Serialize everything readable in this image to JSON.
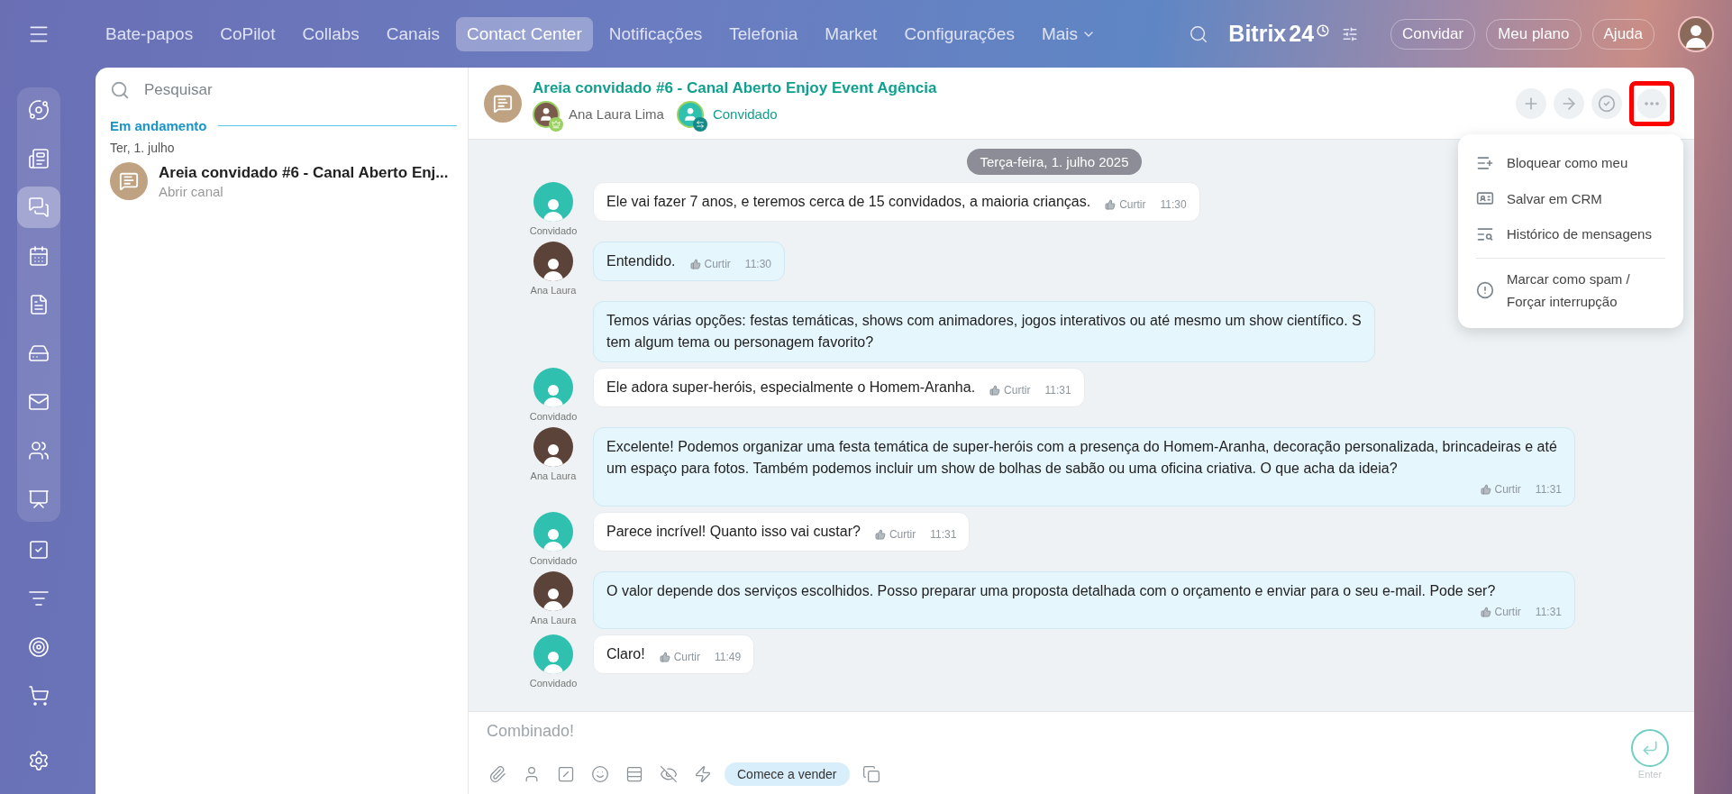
{
  "topbar": {
    "nav": [
      {
        "label": "Bate-papos",
        "selected": false
      },
      {
        "label": "CoPilot",
        "selected": false
      },
      {
        "label": "Collabs",
        "selected": false
      },
      {
        "label": "Canais",
        "selected": false
      },
      {
        "label": "Contact Center",
        "selected": true
      },
      {
        "label": "Notificações",
        "selected": false
      },
      {
        "label": "Telefonia",
        "selected": false
      },
      {
        "label": "Market",
        "selected": false
      },
      {
        "label": "Configurações",
        "selected": false
      },
      {
        "label": "Mais",
        "selected": false,
        "kind": "dropdown"
      }
    ],
    "logo": "Bitrix",
    "logo_number": "24",
    "buttons": [
      "Convidar",
      "Meu plano",
      "Ajuda"
    ]
  },
  "rail": {
    "items": [
      {
        "selected": false
      },
      {
        "selected": false
      },
      {
        "selected": true
      },
      {
        "selected": false
      },
      {
        "selected": false
      },
      {
        "selected": false
      },
      {
        "selected": false
      },
      {
        "selected": false
      },
      {
        "selected": false
      },
      {
        "selected": false
      },
      {
        "selected": false
      },
      {
        "selected": false
      },
      {
        "selected": false
      }
    ]
  },
  "sidebar": {
    "search": {
      "placeholder": "Pesquisar"
    },
    "section": "Em andamento",
    "date": "Ter, 1. julho",
    "items": [
      {
        "title": "Areia convidado #6 - Canal Aberto Enj...",
        "subtitle": "Abrir canal",
        "selected": false
      }
    ]
  },
  "chat": {
    "title": "Areia convidado #6 - Canal Aberto Enjoy Event Agência",
    "members": [
      {
        "name": "Ana Laura Lima",
        "kind": "agent"
      },
      {
        "name": "Convidado",
        "kind": "guest"
      }
    ],
    "actions": [
      {
        "highlighted": false
      },
      {
        "highlighted": false
      },
      {
        "highlighted": false
      },
      {
        "highlighted": true
      }
    ],
    "date_pill": "Terça-feira, 1. julho 2025",
    "messages": [
      {
        "kind": "guest",
        "author": "Convidado",
        "text": "Ele vai fazer 7 anos, e teremos cerca de 15 convidados, a maioria crianças.",
        "like": "Curtir",
        "time": "11:30"
      },
      {
        "kind": "agent",
        "author": "Ana Laura",
        "text": "Entendido.",
        "like": "Curtir",
        "time": "11:30"
      },
      {
        "kind": "agent",
        "text": "Temos várias opções: festas temáticas, shows com animadores, jogos interativos ou até mesmo um show científico. S\ntem algum tema ou personagem favorito?"
      },
      {
        "kind": "guest",
        "author": "Convidado",
        "text": "Ele adora super-heróis, especialmente o Homem-Aranha.",
        "like": "Curtir",
        "time": "11:31"
      },
      {
        "kind": "agent",
        "author": "Ana Laura",
        "text": "Excelente! Podemos organizar uma festa temática de super-heróis com a presença do Homem-Aranha, decoração personalizada, brincadeiras e até um espaço para fotos. Também podemos incluir um show de bolhas de sabão ou uma oficina criativa. O que acha da ideia?",
        "like": "Curtir",
        "time": "11:31"
      },
      {
        "kind": "guest",
        "author": "Convidado",
        "text": "Parece incrível! Quanto isso vai custar?",
        "like": "Curtir",
        "time": "11:31"
      },
      {
        "kind": "agent",
        "author": "Ana Laura",
        "text": "O valor depende dos serviços escolhidos. Posso preparar uma proposta detalhada com o orçamento e enviar para o seu e-mail. Pode ser?",
        "like": "Curtir",
        "time": "11:31"
      },
      {
        "kind": "guest",
        "author": "Convidado",
        "text": "Claro!",
        "like": "Curtir",
        "time": "11:49"
      }
    ],
    "menu": [
      {
        "label": "Bloquear como meu",
        "separated": false
      },
      {
        "label": "Salvar em CRM",
        "separated": false
      },
      {
        "label": "Histórico de mensagens",
        "separated": false
      },
      {
        "label": "Marcar como spam /\nForçar interrupção",
        "separated": true
      }
    ],
    "composer": {
      "placeholder": "Combinado!",
      "sell_button": "Comece a vender",
      "send_hint": "Enter"
    }
  }
}
